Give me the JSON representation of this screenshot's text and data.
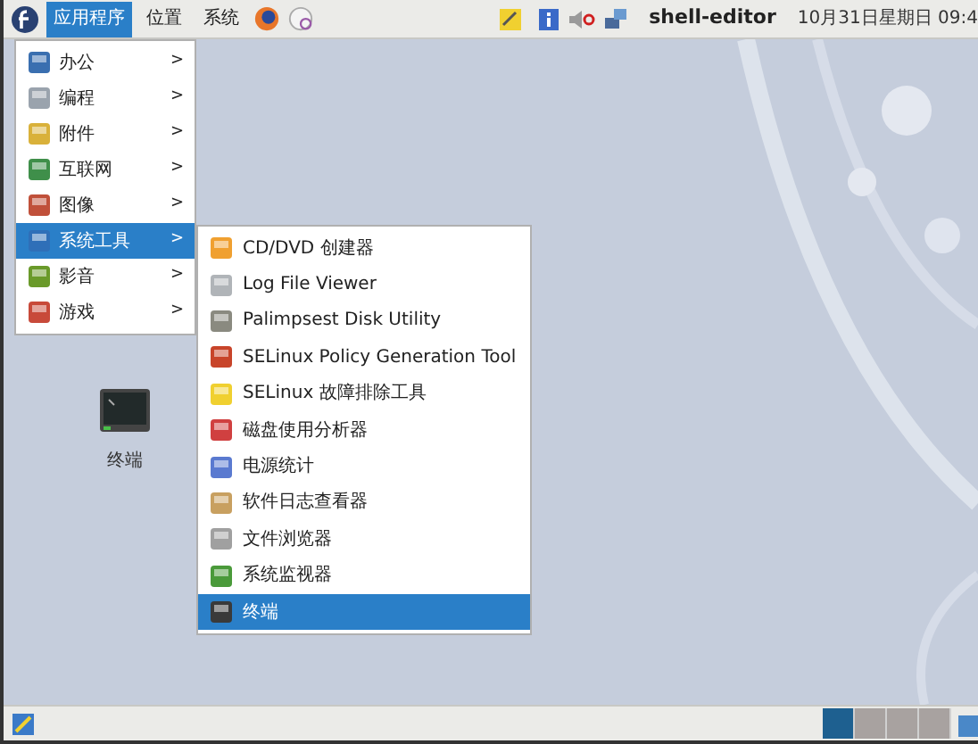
{
  "top_panel": {
    "menus": [
      {
        "label": "应用程序",
        "selected": true
      },
      {
        "label": "位置",
        "selected": false
      },
      {
        "label": "系统",
        "selected": false
      }
    ],
    "user": "shell-editor",
    "clock": "10月31日星期日 09:4"
  },
  "applications_menu": [
    {
      "label": "办公",
      "selected": false,
      "arrow": ">"
    },
    {
      "label": "编程",
      "selected": false,
      "arrow": ">"
    },
    {
      "label": "附件",
      "selected": false,
      "arrow": ">"
    },
    {
      "label": "互联网",
      "selected": false,
      "arrow": ">"
    },
    {
      "label": "图像",
      "selected": false,
      "arrow": ">"
    },
    {
      "label": "系统工具",
      "selected": true,
      "arrow": ">"
    },
    {
      "label": "影音",
      "selected": false,
      "arrow": ">"
    },
    {
      "label": "游戏",
      "selected": false,
      "arrow": ">"
    }
  ],
  "system_tools_menu": [
    {
      "label": "CD/DVD 创建器",
      "selected": false
    },
    {
      "label": "Log File Viewer",
      "selected": false
    },
    {
      "label": "Palimpsest Disk Utility",
      "selected": false
    },
    {
      "label": "SELinux Policy Generation Tool",
      "selected": false
    },
    {
      "label": "SELinux 故障排除工具",
      "selected": false
    },
    {
      "label": "磁盘使用分析器",
      "selected": false
    },
    {
      "label": "电源统计",
      "selected": false
    },
    {
      "label": "软件日志查看器",
      "selected": false
    },
    {
      "label": "文件浏览器",
      "selected": false
    },
    {
      "label": "系统监视器",
      "selected": false
    },
    {
      "label": "终端",
      "selected": true
    }
  ],
  "desktop_icons": [
    {
      "label": "终端"
    }
  ],
  "workspaces": [
    {
      "selected": true
    },
    {
      "selected": false
    },
    {
      "selected": false
    },
    {
      "selected": false
    }
  ]
}
